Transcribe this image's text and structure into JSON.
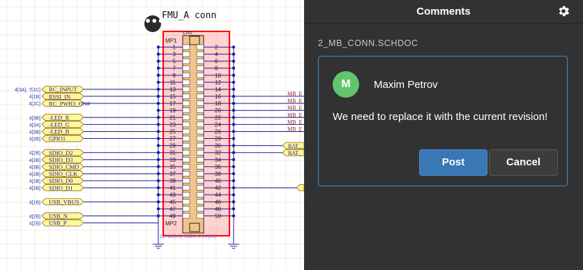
{
  "schematic": {
    "component_title": "FMU_A conn",
    "comment_marker": "•••",
    "refdes": "CN1",
    "mount_top": "MP1",
    "mount_bottom": "MP2",
    "part_number": "DF12(3.0)-50DS-0.5V(86)",
    "pins_left": [
      "1",
      "3",
      "5",
      "7",
      "9",
      "11",
      "13",
      "15",
      "17",
      "19",
      "21",
      "23",
      "25",
      "27",
      "29",
      "31",
      "33",
      "35",
      "37",
      "39",
      "41",
      "43",
      "45",
      "47",
      "49"
    ],
    "pins_right": [
      "2",
      "4",
      "6",
      "8",
      "10",
      "12",
      "14",
      "16",
      "18",
      "20",
      "22",
      "24",
      "26",
      "28",
      "30",
      "32",
      "34",
      "36",
      "38",
      "40",
      "42",
      "44",
      "46",
      "48",
      "50"
    ],
    "left_nets": [
      {
        "row": 6,
        "label": "RC_INPUT",
        "ref": "4[3A], 7[1C]"
      },
      {
        "row": 7,
        "label": "RSSI_IN",
        "ref": "4[1B]"
      },
      {
        "row": 8,
        "label": "RC_PWR3_ON#",
        "ref": "4[2C]"
      },
      {
        "row": 10,
        "label": "-LED_R",
        "ref": "4[3B]"
      },
      {
        "row": 11,
        "label": "-LED_G",
        "ref": "4[3A]"
      },
      {
        "row": 12,
        "label": "-LED_B",
        "ref": "4[3B]"
      },
      {
        "row": 13,
        "label": "GPIO1",
        "ref": "4[3B]"
      },
      {
        "row": 15,
        "label": "SDIO_D2",
        "ref": "4[2B]"
      },
      {
        "row": 16,
        "label": "SDIO_D3",
        "ref": "4[2B]"
      },
      {
        "row": 17,
        "label": "SDIO_CMD",
        "ref": "4[3B]"
      },
      {
        "row": 18,
        "label": "SDIO_CLK",
        "ref": "4[2B]"
      },
      {
        "row": 19,
        "label": "SDIO_D0",
        "ref": "4[2B]"
      },
      {
        "row": 20,
        "label": "SDIO_D1",
        "ref": "4[2B]"
      },
      {
        "row": 22,
        "label": "USB_VBUS",
        "ref": "4[1B]"
      },
      {
        "row": 24,
        "label": "USB_N",
        "ref": "4[2B]"
      },
      {
        "row": 25,
        "label": "USB_P",
        "ref": "4[2B]"
      }
    ],
    "right_nets": [
      {
        "row": 7,
        "label": "MB_E"
      },
      {
        "row": 8,
        "label": "MB_E"
      },
      {
        "row": 9,
        "label": "MB_E"
      },
      {
        "row": 10,
        "label": "MB_E"
      },
      {
        "row": 11,
        "label": "MB_E"
      },
      {
        "row": 12,
        "label": "MB_E"
      }
    ],
    "right_ports": [
      {
        "row": 14,
        "label": "BAT_"
      },
      {
        "row": 15,
        "label": "BAT_"
      }
    ]
  },
  "panel": {
    "title": "Comments",
    "settings_icon": "gear-icon",
    "document_name": "2_MB_CONN.SCHDOC",
    "comment": {
      "avatar_initial": "M",
      "author": "Maxim Petrov",
      "text": "We need to replace it with the current revision!"
    },
    "buttons": {
      "post": "Post",
      "cancel": "Cancel"
    },
    "colors": {
      "panel_bg": "#323232",
      "accent": "#3b8bd2",
      "post_button": "#3a78b5",
      "cancel_button": "#3c3c3c",
      "avatar": "#62c46b",
      "selection": "#ff0000",
      "net": "#1a1aa0",
      "port_fill": "#fff6a0"
    }
  }
}
